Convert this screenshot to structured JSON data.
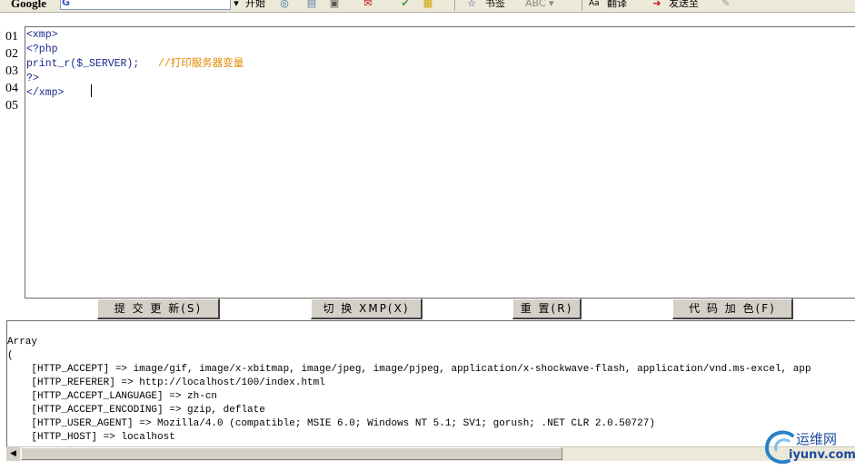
{
  "toolbar": {
    "google_logo": "Google",
    "engine_glyph": "G",
    "search_value": "",
    "start_label": "开始",
    "bookmarks_label": "书签",
    "translate_label": "翻译",
    "send_label": "发送至"
  },
  "editor": {
    "line_numbers": [
      "01",
      "02",
      "03",
      "04",
      "05"
    ],
    "lines": [
      {
        "code": "<xmp>",
        "comment": ""
      },
      {
        "code": "<?php",
        "comment": ""
      },
      {
        "code": "print_r($_SERVER);   ",
        "comment": "//打印服务器变量"
      },
      {
        "code": "?>",
        "comment": ""
      },
      {
        "code": "</xmp>",
        "comment": ""
      }
    ]
  },
  "buttons": {
    "submit": "提 交 更 新(S)",
    "toggle_xmp": "切 换 XMP(X)",
    "reset": "重 置(R)",
    "highlight": "代 码 加 色(F)"
  },
  "output": {
    "lines": [
      "",
      "Array",
      "(",
      "    [HTTP_ACCEPT] => image/gif, image/x-xbitmap, image/jpeg, image/pjpeg, application/x-shockwave-flash, application/vnd.ms-excel, app",
      "    [HTTP_REFERER] => http://localhost/100/index.html",
      "    [HTTP_ACCEPT_LANGUAGE] => zh-cn",
      "    [HTTP_ACCEPT_ENCODING] => gzip, deflate",
      "    [HTTP_USER_AGENT] => Mozilla/4.0 (compatible; MSIE 6.0; Windows NT 5.1; SV1; gorush; .NET CLR 2.0.50727)",
      "    [HTTP_HOST] => localhost"
    ]
  },
  "watermark": {
    "cn": "运维网",
    "en": "iyunv.com"
  }
}
